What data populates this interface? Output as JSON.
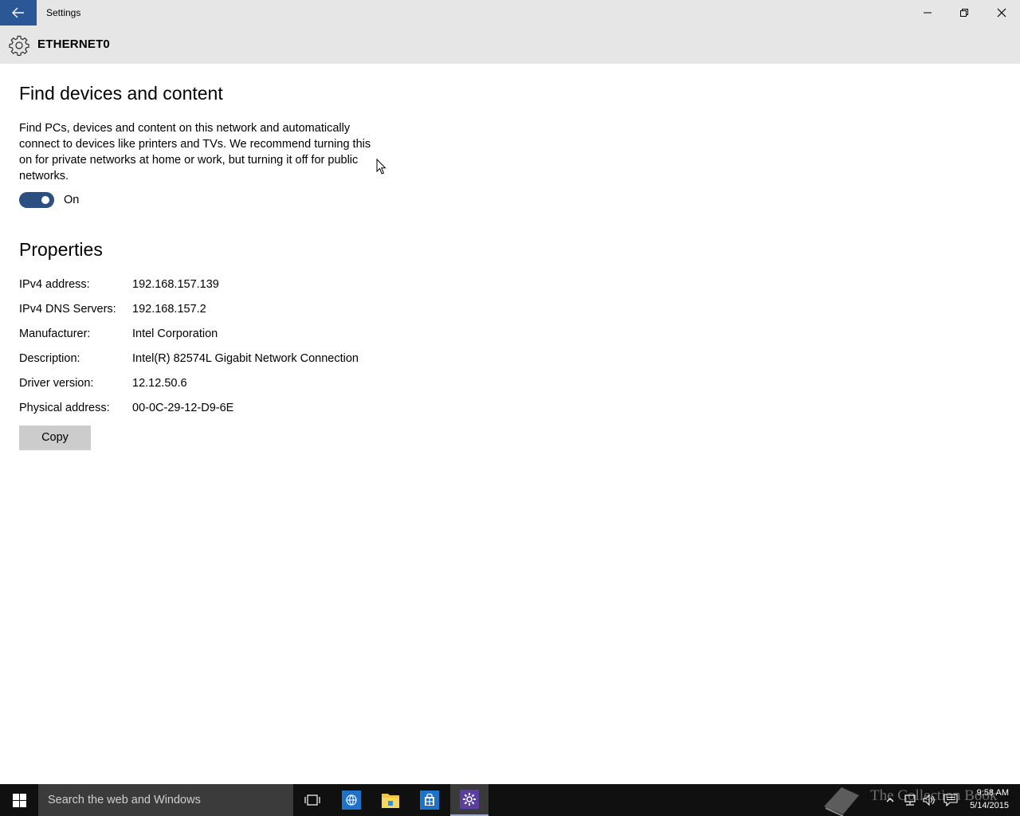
{
  "window": {
    "title": "Settings"
  },
  "header": {
    "title": "ETHERNET0"
  },
  "find_devices": {
    "title": "Find devices and content",
    "description": "Find PCs, devices and content on this network and automatically connect to devices like printers and TVs. We recommend turning this on for private networks at home or work, but turning it off for public networks.",
    "toggle_state": "On",
    "toggle_on": true
  },
  "properties": {
    "title": "Properties",
    "items": [
      {
        "label": "IPv4 address:",
        "value": "192.168.157.139"
      },
      {
        "label": "IPv4 DNS Servers:",
        "value": "192.168.157.2"
      },
      {
        "label": "Manufacturer:",
        "value": "Intel Corporation"
      },
      {
        "label": "Description:",
        "value": "Intel(R) 82574L Gigabit Network Connection"
      },
      {
        "label": "Driver version:",
        "value": "12.12.50.6"
      },
      {
        "label": "Physical address:",
        "value": "00-0C-29-12-D9-6E"
      }
    ],
    "copy_label": "Copy"
  },
  "taskbar": {
    "search_placeholder": "Search the web and Windows",
    "watermark": "The Collection Book",
    "time": "9:58 AM",
    "date": "5/14/2015"
  },
  "colors": {
    "accent": "#2b5797",
    "toggle_on": "#2b4f81",
    "titlebar_bg": "#e6e6e6",
    "taskbar_bg": "#101010"
  },
  "icons": [
    "back-arrow-icon",
    "minimize-icon",
    "restore-icon",
    "close-icon",
    "gear-icon",
    "mouse-cursor-icon",
    "windows-logo-icon",
    "task-view-icon",
    "internet-explorer-icon",
    "file-explorer-icon",
    "store-icon",
    "settings-gear-icon",
    "book-icon",
    "chevron-up-icon",
    "network-icon",
    "volume-icon",
    "action-center-icon"
  ]
}
